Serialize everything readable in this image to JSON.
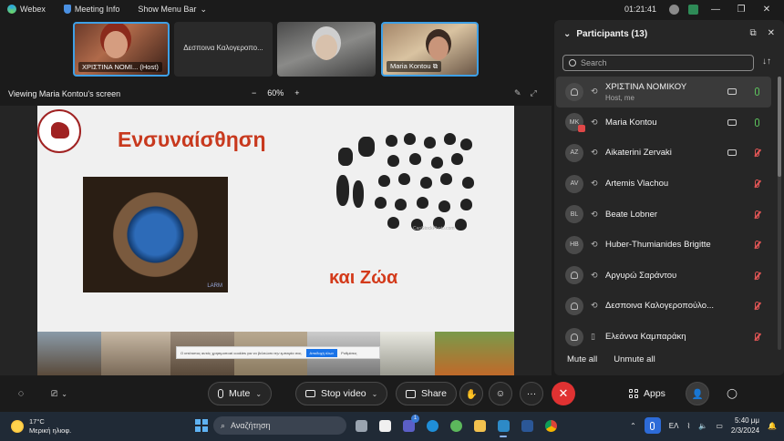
{
  "titlebar": {
    "app_name": "Webex",
    "meeting_info": "Meeting Info",
    "show_menu_bar": "Show Menu Bar",
    "chevron": "⌄",
    "timer": "01:21:41",
    "minimize": "—",
    "restore": "❐",
    "close": "✕"
  },
  "thumbnails": [
    {
      "name": "ΧΡΙΣΤΙΝΑ ΝΟΜΙ... (Host)"
    },
    {
      "name": "Δεσποινα Καλογεροπο..."
    },
    {
      "name": ""
    },
    {
      "name": "Maria Kontou"
    }
  ],
  "viewbar": {
    "label": "Viewing Maria Kontou's screen",
    "zoom_out": "−",
    "zoom_level": "60%",
    "zoom_in": "+"
  },
  "slide": {
    "title1": "Ενσυναίσθηση",
    "title2": "και Ζώα",
    "image_tag": "LARM",
    "credit": "CanStockPhoto.com",
    "cookie_text": "Ο ιστότοπος αυτός χρησιμοποιεί cookies για να βελτιώσει την εμπειρία σας.",
    "cookie_accept": "Αποδοχή όλων",
    "cookie_settings": "Ρυθμίσεις"
  },
  "participants": {
    "title": "Participants (13)",
    "search_placeholder": "Search",
    "sort_icon": "↓↑",
    "list": [
      {
        "name": "ΧΡΙΣΤΙΝΑ ΝΟΜΙΚΟΥ",
        "sub": "Host, me",
        "initials": "",
        "video": true,
        "mic": "on",
        "me": true
      },
      {
        "name": "Maria Kontou",
        "initials": "MK",
        "video": true,
        "mic": "on",
        "presenter": true
      },
      {
        "name": "Aikaterini Zervaki",
        "initials": "AZ",
        "video": true,
        "mic": "off"
      },
      {
        "name": "Artemis Vlachou",
        "initials": "AV",
        "video": false,
        "mic": "off"
      },
      {
        "name": "Beate Lobner",
        "initials": "BL",
        "video": false,
        "mic": "off"
      },
      {
        "name": "Huber-Thumianides Brigitte",
        "initials": "HB",
        "video": false,
        "mic": "off"
      },
      {
        "name": "Αργυρώ Σαράντου",
        "initials": "",
        "video": false,
        "mic": "off"
      },
      {
        "name": "Δεσποινα Καλογεροπούλο...",
        "initials": "",
        "video": false,
        "mic": "off"
      },
      {
        "name": "Ελεάννα Καμπαράκη",
        "initials": "",
        "video": false,
        "mic": "off"
      }
    ],
    "mute_all": "Mute all",
    "unmute_all": "Unmute all"
  },
  "controls": {
    "mute": "Mute",
    "stop_video": "Stop video",
    "share": "Share",
    "apps": "Apps",
    "more": "···",
    "end": "✕",
    "chevron": "⌄"
  },
  "taskbar": {
    "temperature": "17°C",
    "weather": "Μερική ηλιοφ.",
    "search_placeholder": "Αναζήτηση",
    "notification_count": "1",
    "language": "ΕΛ",
    "time": "5:40 μμ",
    "date": "2/3/2024"
  },
  "colors": {
    "accent": "#3ea0e6",
    "end_call": "#e03232",
    "mic_on": "#5cc15c",
    "mic_off": "#e05555"
  }
}
